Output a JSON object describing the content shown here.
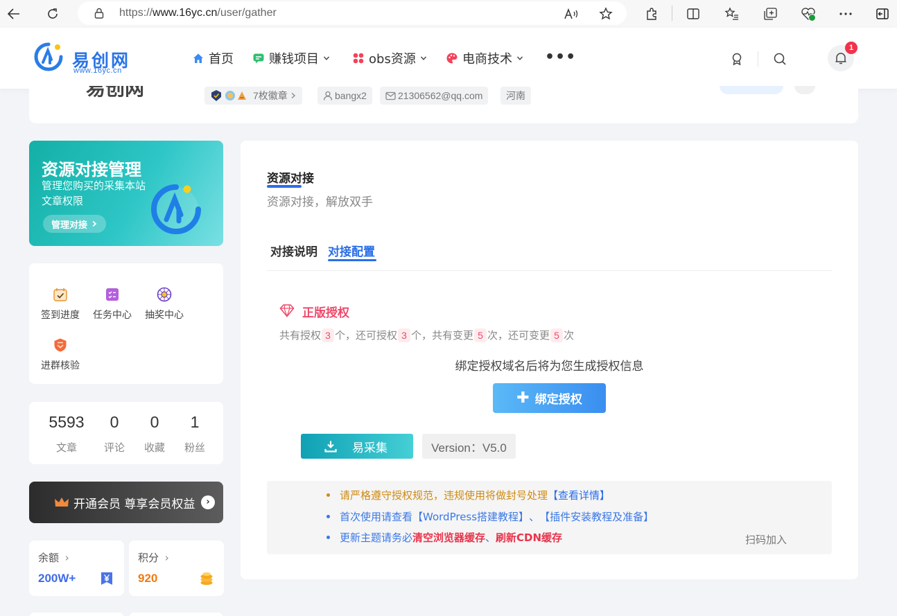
{
  "browser": {
    "url_prefix": "https://",
    "url_host": "www.16yc.cn",
    "url_path": "/user/gather"
  },
  "header": {
    "logo_text": "易创网",
    "logo_sub": "www.16yc.cn",
    "nav": [
      {
        "label": "首页",
        "icon": "home-icon"
      },
      {
        "label": "赚钱项目",
        "icon": "chat-icon"
      },
      {
        "label": "obs资源",
        "icon": "dots-grid-icon"
      },
      {
        "label": "电商技术",
        "icon": "palette-icon"
      }
    ],
    "more_label": "•••",
    "notification_count": "1"
  },
  "profile": {
    "name_stub": "易创网",
    "medals": "7枚徽章",
    "username": "bangx2",
    "email": "21306562@qq.com",
    "region": "河南"
  },
  "promo": {
    "title": "资源对接管理",
    "desc": "管理您购买的采集本站文章权限",
    "button": "管理对接"
  },
  "quick_links": [
    {
      "label": "签到进度",
      "icon": "calendar-check-icon"
    },
    {
      "label": "任务中心",
      "icon": "task-list-icon"
    },
    {
      "label": "抽奖中心",
      "icon": "lottery-wheel-icon"
    },
    {
      "label": "进群核验",
      "icon": "shield-badge-icon"
    }
  ],
  "stats": [
    {
      "value": "5593",
      "label": "文章"
    },
    {
      "value": "0",
      "label": "评论"
    },
    {
      "value": "0",
      "label": "收藏"
    },
    {
      "value": "1",
      "label": "粉丝"
    }
  ],
  "vip_banner": "开通会员 尊享会员权益",
  "wallet": {
    "balance_label": "余额",
    "balance_value": "200W+",
    "points_label": "积分",
    "points_value": "920"
  },
  "main": {
    "section_title": "资源对接",
    "section_subtitle": "资源对接，解放双手",
    "tabs": [
      "对接说明",
      "对接配置"
    ],
    "active_tab": 1,
    "auth_title": "正版授权",
    "auth_line": {
      "p1": "共有授权",
      "total": "3",
      "p2": "个，还可授权",
      "remain": "3",
      "p3": "个，共有变更",
      "changes": "5",
      "p4": "次，还可变更",
      "changes_left": "5",
      "p5": "次"
    },
    "bind_hint": "绑定授权域名后将为您生成授权信息",
    "bind_button": "绑定授权",
    "download_button": "易采集",
    "version": "Version：V5.0",
    "notices": {
      "n1_text": "请严格遵守授权规范，违规使用将做封号处理",
      "n1_link": "【查看详情】",
      "n2_a": "首次使用请查看",
      "n2_b": "【WordPress搭建教程】",
      "n2_c": "、",
      "n2_d": "【插件安装教程及准备】",
      "n3_a": "更新主题请务必",
      "n3_b": "清空浏览器缓存",
      "n3_c": "、",
      "n3_d": "刷新CDN缓存",
      "scan": "扫码加入"
    }
  },
  "colors": {
    "accent_blue": "#2a6ee8",
    "teal": "#13b0a6",
    "auth_pink": "#ef4a6a",
    "warn_orange": "#cf8a13"
  }
}
